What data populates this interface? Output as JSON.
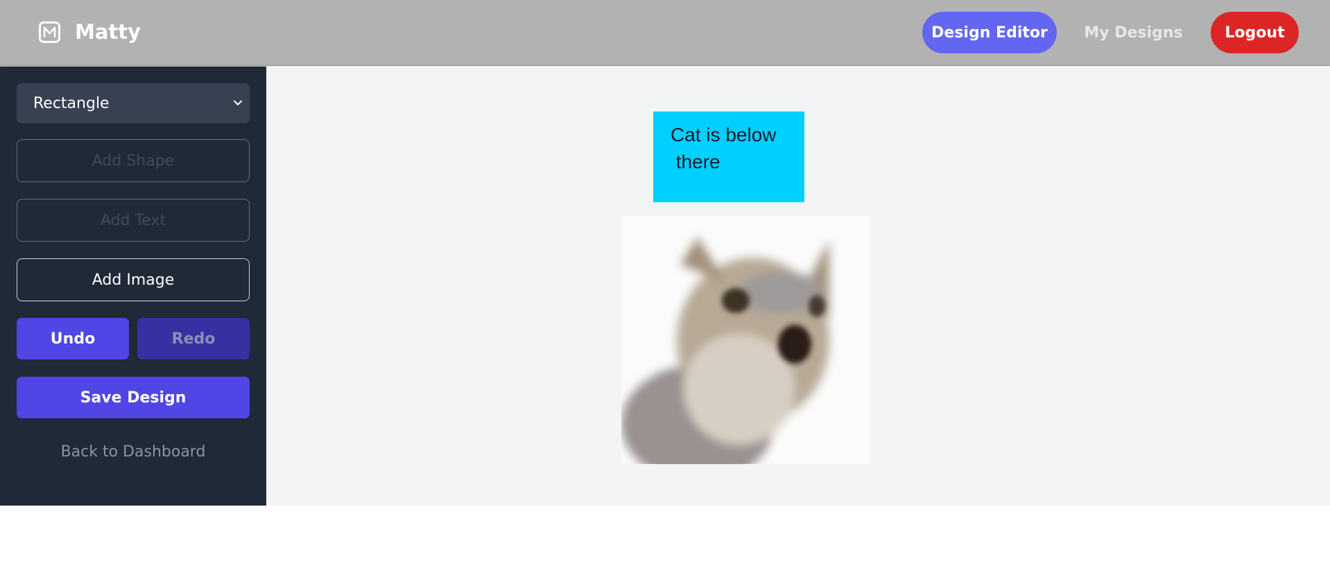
{
  "navbar": {
    "brand": "Matty",
    "logo_icon": "m-logo-icon",
    "links": {
      "design_editor": "Design Editor",
      "my_designs": "My Designs",
      "logout": "Logout"
    },
    "colors": {
      "background": "#b2b2b2",
      "active": "#6366f1",
      "logout": "#dc2626"
    }
  },
  "sidebar": {
    "shape_select": {
      "value": "Rectangle",
      "icon": "chevron-down-icon"
    },
    "add_shape": "Add Shape",
    "add_text": "Add Text",
    "add_image": "Add Image",
    "undo": "Undo",
    "redo": "Redo",
    "save": "Save Design",
    "back": "Back to Dashboard",
    "colors": {
      "background": "#1f2937",
      "primary": "#4f46e5"
    }
  },
  "canvas": {
    "text_element": {
      "text": "Cat is below\n there",
      "color": "#00d0ff"
    },
    "image_element": {
      "description_icon": "cat-photo"
    }
  }
}
